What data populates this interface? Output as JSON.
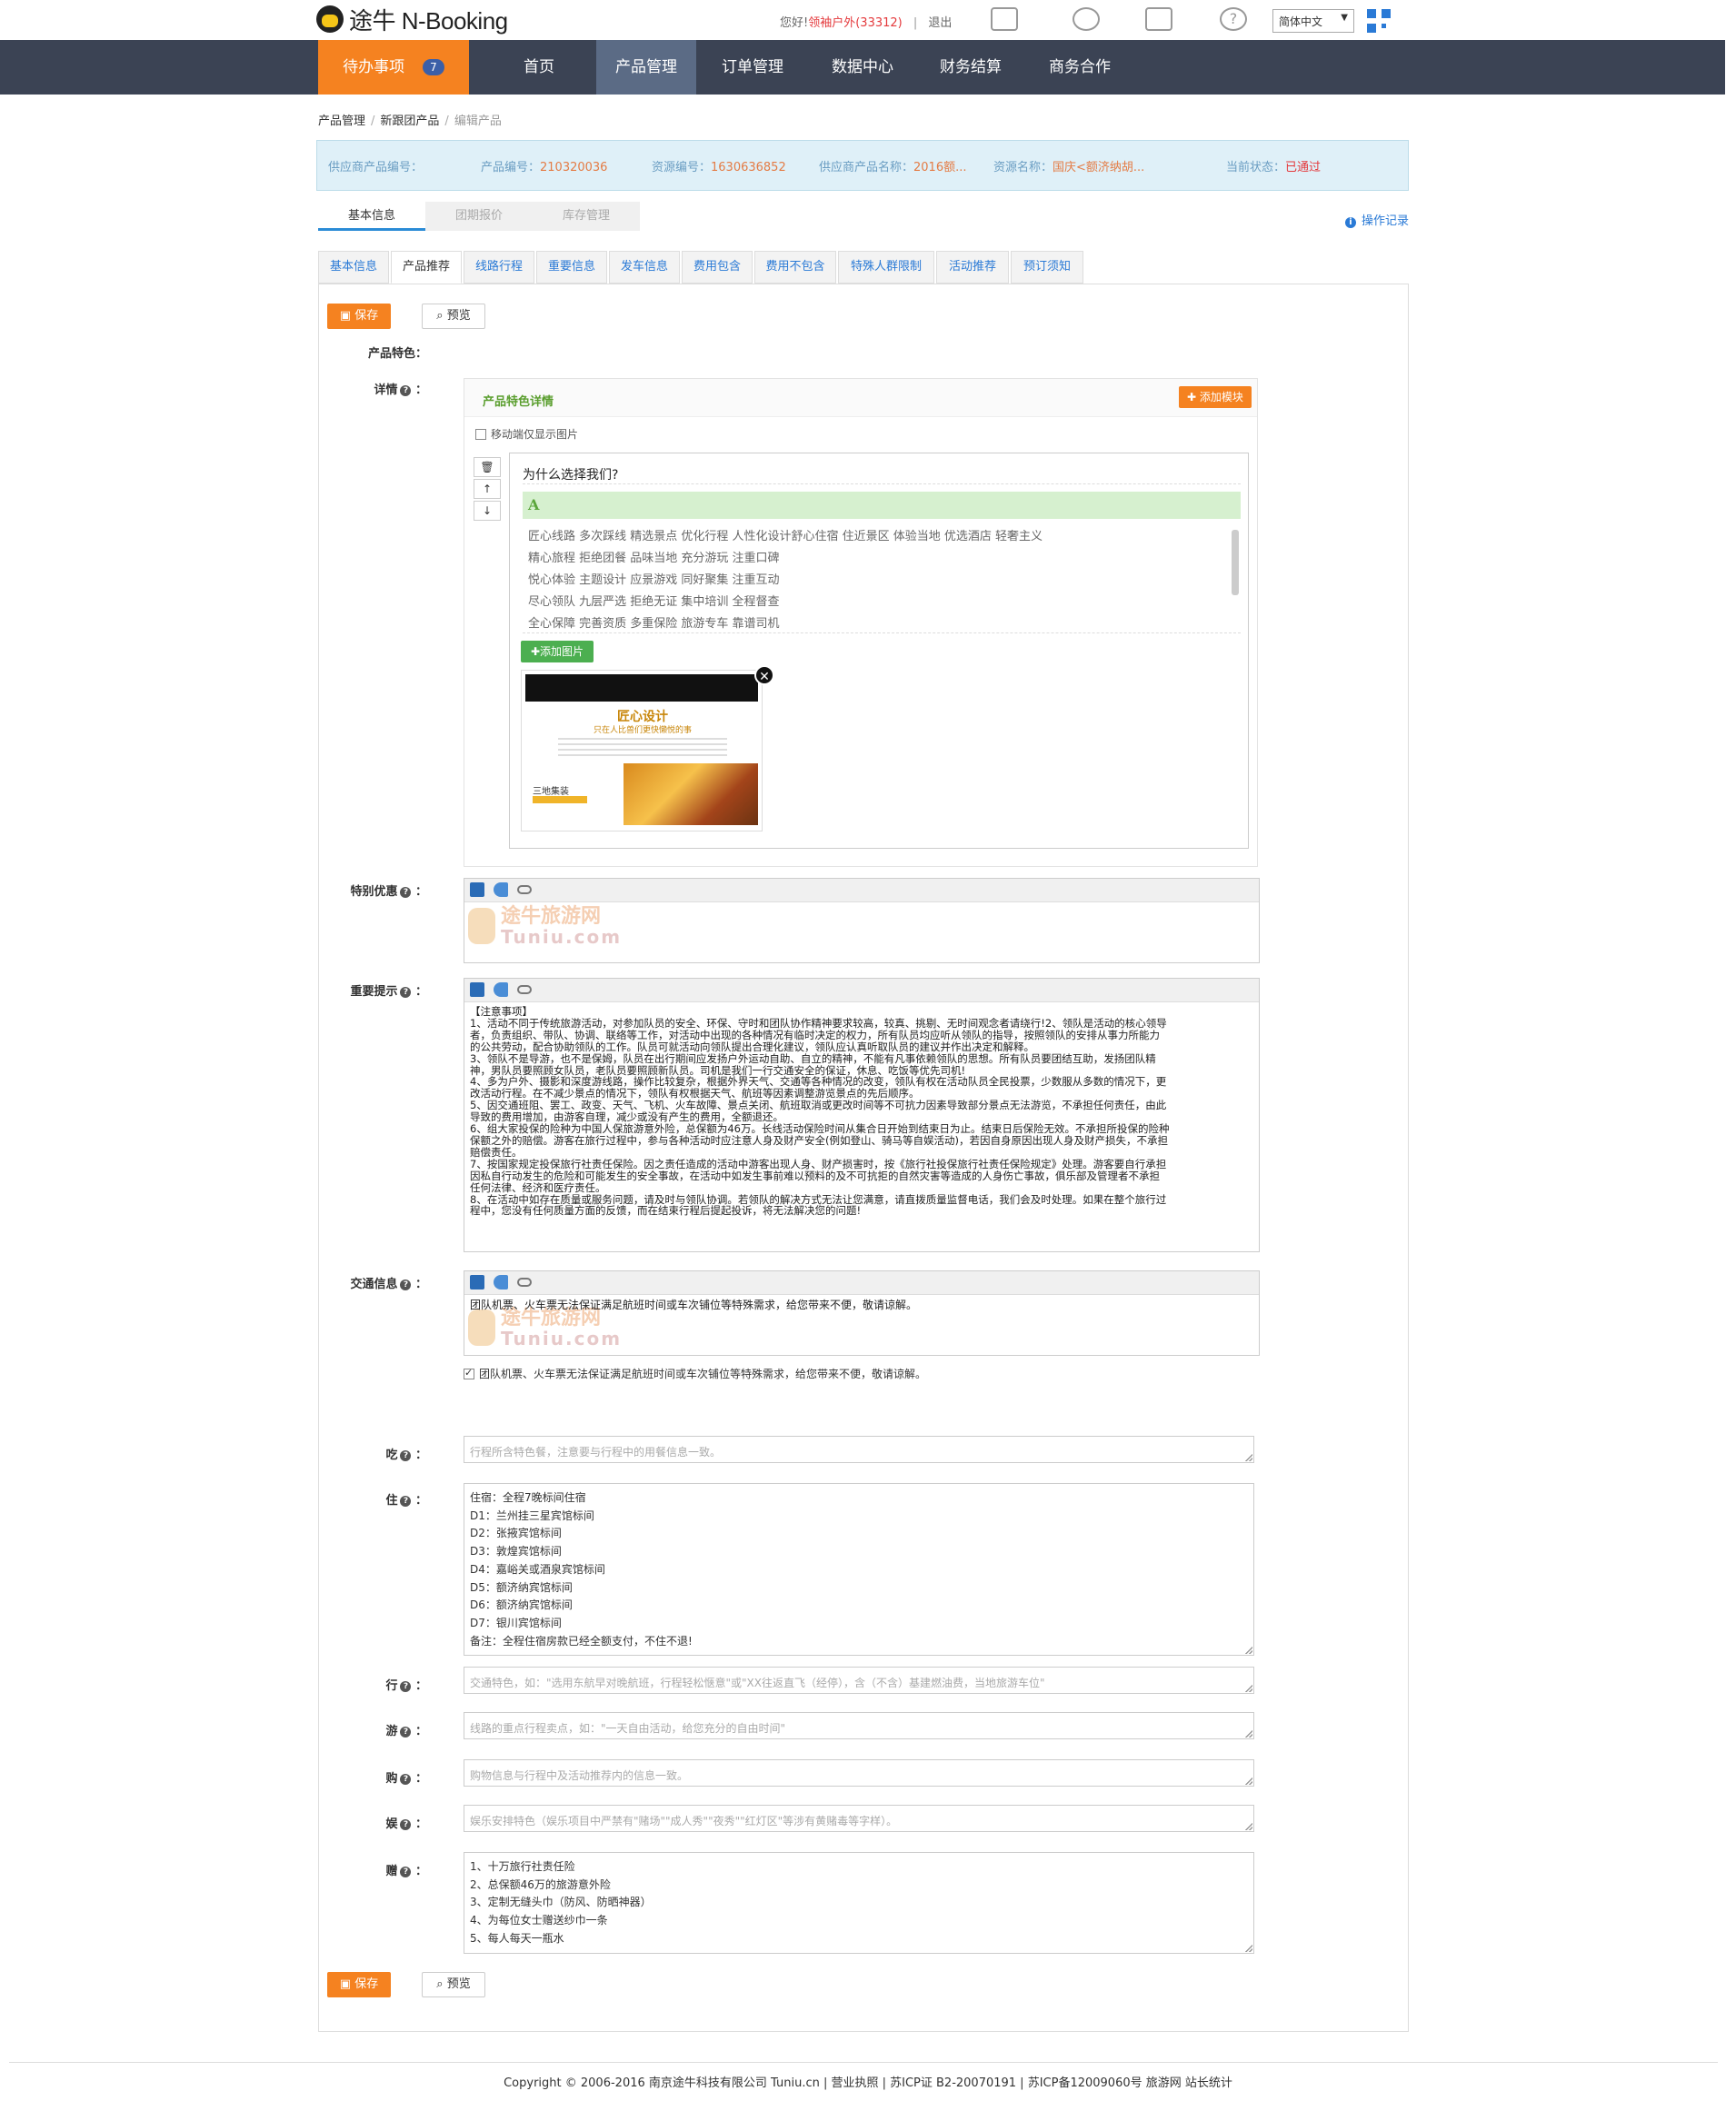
{
  "header": {
    "logo_text": "途牛 N-Booking",
    "greeting_prefix": "您好!",
    "username": "领袖户外",
    "user_id": "(33312)",
    "separator": "|",
    "logout": "退出",
    "language": "简体中文"
  },
  "nav": {
    "todo_label": "待办事项",
    "todo_count": "7",
    "items": [
      "首页",
      "产品管理",
      "订单管理",
      "数据中心",
      "财务结算",
      "商务合作"
    ]
  },
  "breadcrumb": [
    "产品管理",
    "新跟团产品",
    "编辑产品"
  ],
  "info": {
    "supplier_code_label": "供应商产品编号：",
    "product_code_label": "产品编号：",
    "product_code": "210320036",
    "resource_code_label": "资源编号：",
    "resource_code": "1630636852",
    "supplier_name_label": "供应商产品名称：",
    "supplier_name": "2016额...",
    "resource_name_label": "资源名称：",
    "resource_name": "国庆<额济纳胡...",
    "status_label": "当前状态：",
    "status": "已通过"
  },
  "tabs_top": [
    "基本信息",
    "团期报价",
    "库存管理"
  ],
  "op_log": "操作记录",
  "tabs_sub": [
    "基本信息",
    "产品推荐",
    "线路行程",
    "重要信息",
    "发车信息",
    "费用包含",
    "费用不包含",
    "特殊人群限制",
    "活动推荐",
    "预订须知"
  ],
  "buttons": {
    "save": "保存",
    "preview": "预览"
  },
  "form": {
    "feature_label": "产品特色：",
    "detail_label": "详情",
    "detail_box_title": "产品特色详情",
    "add_module": "添加模块",
    "mobile_only": "移动端仅显示图片",
    "module_title": "为什么选择我们?",
    "module_letter": "A",
    "module_lines": [
      "匠心线路 多次踩线 精选景点 优化行程 人性化设计舒心住宿 住近景区 体验当地 优选酒店 轻奢主义",
      "精心旅程 拒绝团餐 品味当地 充分游玩 注重口碑",
      "悦心体验 主题设计 应景游戏 同好聚集 注重互动",
      "尽心领队 九层严选 拒绝无证 集中培训 全程督查",
      "全心保障 完善资质 多重保险 旅游专车 靠谱司机"
    ],
    "add_image": "添加图片",
    "thumb_title": "匠心设计",
    "thumb_sub": "只在人比兽们更快懒悦的事",
    "thumb_small": "三地集装",
    "special_label": "特别优惠",
    "notes_label": "重要提示",
    "notes_lines": [
      "【注意事项】",
      "1、活动不同于传统旅游活动，对参加队员的安全、环保、守时和团队协作精神要求较高，较真、挑剔、无时间观念者请绕行!2、领队是活动的核心领导",
      "者，负责组织、带队、协调、联络等工作，对活动中出现的各种情况有临时决定的权力，所有队员均应听从领队的指导，按照领队的安排从事力所能力",
      "的公共劳动，配合协助领队的工作。队员可就活动向领队提出合理化建议，领队应认真听取队员的建议并作出决定和解释。",
      "3、领队不是导游，也不是保姆，队员在出行期间应发扬户外运动自助、自立的精神，不能有凡事依赖领队的思想。所有队员要团结互助，发扬团队精",
      "神，男队员要照顾女队员，老队员要照顾新队员。司机是我们一行交通安全的保证，休息、吃饭等优先司机!",
      "4、多为户外、摄影和深度游线路，操作比较复杂，根据外界天气、交通等各种情况的改变，领队有权在活动队员全民投票，少数服从多数的情况下，更",
      "改活动行程。在不减少景点的情况下，领队有权根据天气、航班等因素调整游览景点的先后顺序。",
      "5、因交通班阻、罢工、政变、天气、飞机、火车故障、景点关闭、航班取消或更改时间等不可抗力因素导致部分景点无法游览，不承担任何责任，由此",
      "导致的费用增加，由游客自理，减少或没有产生的费用，全额退还。",
      "6、组大家投保的险种为中国人保旅游意外险，总保额为46万。长线活动保险时间从集合日开始到结束日为止。结束日后保险无效。不承担所投保的险种",
      "保额之外的赔偿。游客在旅行过程中，参与各种活动时应注意人身及财产安全(例如登山、骑马等自娱活动)，若因自身原因出现人身及财产损失，不承担",
      "赔偿责任。",
      "7、按国家规定投保旅行社责任保险。因之责任造成的活动中游客出现人身、财产损害时，按《旅行社投保旅行社责任保险规定》处理。游客要自行承担",
      "因私自行动发生的危险和可能发生的安全事故，在活动中如发生事前难以预料的及不可抗拒的自然灾害等造成的人身伤亡事故，俱乐部及管理者不承担",
      "任何法律、经济和医疗责任。",
      "8、在活动中如存在质量或服务问题，请及时与领队协调。若领队的解决方式无法让您满意，请直拨质量监督电话，我们会及时处理。如果在整个旅行过",
      "程中，您没有任何质量方面的反馈，而在结束行程后提起投诉，将无法解决您的问题!"
    ],
    "transport_label": "交通信息",
    "transport_text": "团队机票、火车票无法保证满足航班时间或车次铺位等特殊需求，给您带来不便，敬请谅解。",
    "transport_check": "团队机票、火车票无法保证满足航班时间或车次铺位等特殊需求，给您带来不便，敬请谅解。",
    "watermark_cn": "途牛旅游网",
    "watermark_en": "Tuniu.com",
    "eat_label": "吃",
    "eat_placeholder": "行程所含特色餐，注意要与行程中的用餐信息一致。",
    "stay_label": "住",
    "stay_lines": [
      "住宿：全程7晚标间住宿",
      "D1：兰州挂三星宾馆标间",
      "D2：张掖宾馆标间",
      "D3：敦煌宾馆标间",
      "D4：嘉峪关或酒泉宾馆标间",
      "D5：额济纳宾馆标间",
      "D6：额济纳宾馆标间",
      "D7：银川宾馆标间",
      "备注：全程住宿房款已经全额支付，不住不退!"
    ],
    "go_label": "行",
    "go_placeholder": "交通特色，如：\"选用东航早对晚航班，行程轻松惬意\"或\"XX往返直飞（经停），含（不含）基建燃油费，当地旅游车位\"",
    "tour_label": "游",
    "tour_placeholder": "线路的重点行程卖点，如：\"一天自由活动，给您充分的自由时间\"",
    "shop_label": "购",
    "shop_placeholder": "购物信息与行程中及活动推荐内的信息一致。",
    "fun_label": "娱",
    "fun_placeholder": "娱乐安排特色（娱乐项目中严禁有\"赌场\"\"成人秀\"\"夜秀\"\"红灯区\"等涉有黄赌毒等字样）。",
    "gift_label": "赠",
    "gift_lines": [
      "1、十万旅行社责任险",
      "2、总保额46万的旅游意外险",
      "3、定制无缝头巾（防风、防晒神器）",
      "4、为每位女士赠送纱巾一条",
      "5、每人每天一瓶水"
    ]
  },
  "footer": "Copyright © 2006-2016 南京途牛科技有限公司 Tuniu.cn | 营业执照 | 苏ICP证 B2-20070191 | 苏ICP备12009060号 旅游网 站长统计"
}
